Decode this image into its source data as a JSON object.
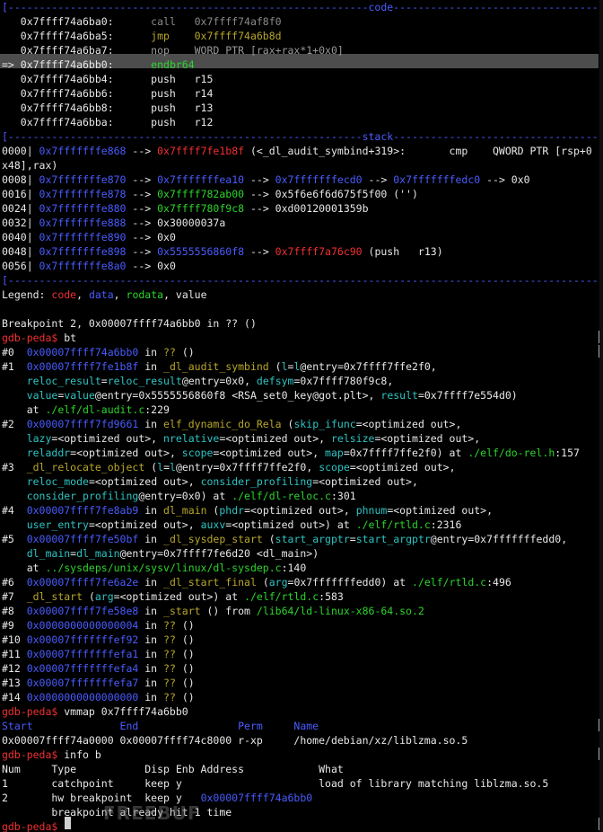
{
  "colors": {
    "background": "#000000",
    "text": "#e8e8e8",
    "code_blue": "#4a5cff",
    "data_green": "#2bd52b",
    "rodata_red": "#f03030",
    "prompt_red": "#f03030",
    "cyan": "#2ec3c3",
    "yellow": "#b8a62a",
    "magenta": "#c64fc6",
    "highlight": "#4d4d4d"
  },
  "watermark": "FREEBUF",
  "lines": [
    [
      [
        "b",
        "[----------------------------------------------------------code-------------------------------------------------------]"
      ]
    ],
    [
      [
        "w",
        "   0x7ffff74a6ba0:      "
      ],
      [
        "d",
        "call   0x7ffff74af8f0"
      ]
    ],
    [
      [
        "w",
        "   0x7ffff74a6ba5:      "
      ],
      [
        "y",
        "jmp    0x7ffff74a6b8d"
      ]
    ],
    [
      [
        "w",
        "   0x7ffff74a6ba7:      "
      ],
      [
        "dim",
        "nop    WORD PTR [rax+rax*1+0x0]"
      ]
    ],
    [
      [
        "w",
        "=> 0x7ffff74a6bb0:      "
      ],
      [
        "g",
        "endbr64"
      ]
    ],
    [
      [
        "w",
        "   0x7ffff74a6bb4:      push   r15"
      ]
    ],
    [
      [
        "w",
        "   0x7ffff74a6bb6:      push   r14"
      ]
    ],
    [
      [
        "w",
        "   0x7ffff74a6bb8:      push   r13"
      ]
    ],
    [
      [
        "w",
        "   0x7ffff74a6bba:      push   r12"
      ]
    ],
    [
      [
        "b",
        "[---------------------------------------------------------stack-------------------------------------------------------]"
      ]
    ],
    [
      [
        "w",
        "0000| "
      ],
      [
        "b",
        "0x7fffffffe868"
      ],
      [
        "w",
        " --> "
      ],
      [
        "r",
        "0x7ffff7fe1b8f"
      ],
      [
        "w",
        " (<_dl_audit_symbind+319>:       cmp    QWORD PTR [rsp+0"
      ]
    ],
    [
      [
        "w",
        "x48],rax)"
      ]
    ],
    [
      [
        "w",
        "0008| "
      ],
      [
        "b",
        "0x7fffffffe870"
      ],
      [
        "w",
        " --> "
      ],
      [
        "b",
        "0x7fffffffea10"
      ],
      [
        "w",
        " --> "
      ],
      [
        "b",
        "0x7fffffffecd0"
      ],
      [
        "w",
        " --> "
      ],
      [
        "b",
        "0x7fffffffedc0"
      ],
      [
        "w",
        " --> 0x0"
      ]
    ],
    [
      [
        "w",
        "0016| "
      ],
      [
        "b",
        "0x7fffffffe878"
      ],
      [
        "w",
        " --> "
      ],
      [
        "g",
        "0x7ffff782ab00"
      ],
      [
        "w",
        " --> 0x5f6e6f6d675f5f00 ('')"
      ]
    ],
    [
      [
        "w",
        "0024| "
      ],
      [
        "b",
        "0x7fffffffe880"
      ],
      [
        "w",
        " --> "
      ],
      [
        "g",
        "0x7ffff780f9c8"
      ],
      [
        "w",
        " --> 0xd00120001359b"
      ]
    ],
    [
      [
        "w",
        "0032| "
      ],
      [
        "b",
        "0x7fffffffe888"
      ],
      [
        "w",
        " --> 0x30000037a"
      ]
    ],
    [
      [
        "w",
        "0040| "
      ],
      [
        "b",
        "0x7fffffffe890"
      ],
      [
        "w",
        " --> 0x0"
      ]
    ],
    [
      [
        "w",
        "0048| "
      ],
      [
        "b",
        "0x7fffffffe898"
      ],
      [
        "w",
        " --> "
      ],
      [
        "b",
        "0x5555556860f8"
      ],
      [
        "w",
        " --> "
      ],
      [
        "r",
        "0x7ffff7a76c90"
      ],
      [
        "w",
        " (push   r13)"
      ]
    ],
    [
      [
        "w",
        "0056| "
      ],
      [
        "b",
        "0x7fffffffe8a0"
      ],
      [
        "w",
        " --> 0x0"
      ]
    ],
    [
      [
        "b",
        "[-------------------------------------------------------------------------------------------------------------------]"
      ]
    ],
    [
      [
        "w",
        "Legend: "
      ],
      [
        "r",
        "code"
      ],
      [
        "w",
        ", "
      ],
      [
        "b",
        "data"
      ],
      [
        "w",
        ", "
      ],
      [
        "g",
        "rodata"
      ],
      [
        "w",
        ", value"
      ]
    ],
    [
      [
        "w",
        ""
      ]
    ],
    [
      [
        "w",
        "Breakpoint 2, 0x00007ffff74a6bb0 in ?? ()"
      ]
    ],
    [
      [
        "r",
        "gdb-peda$"
      ],
      [
        "w",
        " bt"
      ]
    ],
    [
      [
        "w",
        "#0  "
      ],
      [
        "b",
        "0x00007ffff74a6bb0"
      ],
      [
        "w",
        " in "
      ],
      [
        "y",
        "??"
      ],
      [
        "w",
        " ()"
      ]
    ],
    [
      [
        "w",
        "#1  "
      ],
      [
        "b",
        "0x00007ffff7fe1b8f"
      ],
      [
        "w",
        " in "
      ],
      [
        "y",
        "_dl_audit_symbind"
      ],
      [
        "w",
        " ("
      ],
      [
        "c",
        "l"
      ],
      [
        "w",
        "="
      ],
      [
        "c",
        "l"
      ],
      [
        "w",
        "@entry=0x7ffff7ffe2f0,"
      ]
    ],
    [
      [
        "w",
        "    "
      ],
      [
        "c",
        "reloc_result"
      ],
      [
        "w",
        "="
      ],
      [
        "c",
        "reloc_result"
      ],
      [
        "w",
        "@entry=0x0, "
      ],
      [
        "c",
        "defsym"
      ],
      [
        "w",
        "=0x7ffff780f9c8,"
      ]
    ],
    [
      [
        "w",
        "    "
      ],
      [
        "c",
        "value"
      ],
      [
        "w",
        "="
      ],
      [
        "c",
        "value"
      ],
      [
        "w",
        "@entry=0x5555556860f8 <RSA_set0_key@got.plt>, "
      ],
      [
        "c",
        "result"
      ],
      [
        "w",
        "=0x7ffff7e554d0)"
      ]
    ],
    [
      [
        "w",
        "    at "
      ],
      [
        "g",
        "./elf/dl-audit.c"
      ],
      [
        "w",
        ":229"
      ]
    ],
    [
      [
        "w",
        "#2  "
      ],
      [
        "b",
        "0x00007ffff7fd9661"
      ],
      [
        "w",
        " in "
      ],
      [
        "y",
        "elf_dynamic_do_Rela"
      ],
      [
        "w",
        " ("
      ],
      [
        "c",
        "skip_ifunc"
      ],
      [
        "w",
        "=<optimized out>,"
      ]
    ],
    [
      [
        "w",
        "    "
      ],
      [
        "c",
        "lazy"
      ],
      [
        "w",
        "=<optimized out>, "
      ],
      [
        "c",
        "nrelative"
      ],
      [
        "w",
        "=<optimized out>, "
      ],
      [
        "c",
        "relsize"
      ],
      [
        "w",
        "=<optimized out>,"
      ]
    ],
    [
      [
        "w",
        "    "
      ],
      [
        "c",
        "reladdr"
      ],
      [
        "w",
        "=<optimized out>, "
      ],
      [
        "c",
        "scope"
      ],
      [
        "w",
        "=<optimized out>, "
      ],
      [
        "c",
        "map"
      ],
      [
        "w",
        "=0x7ffff7ffe2f0) at "
      ],
      [
        "g",
        "./elf/do-rel.h"
      ],
      [
        "w",
        ":157"
      ]
    ],
    [
      [
        "w",
        "#3  "
      ],
      [
        "y",
        "_dl_relocate_object"
      ],
      [
        "w",
        " ("
      ],
      [
        "c",
        "l"
      ],
      [
        "w",
        "="
      ],
      [
        "c",
        "l"
      ],
      [
        "w",
        "@entry=0x7ffff7ffe2f0, "
      ],
      [
        "c",
        "scope"
      ],
      [
        "w",
        "=<optimized out>,"
      ]
    ],
    [
      [
        "w",
        "    "
      ],
      [
        "c",
        "reloc_mode"
      ],
      [
        "w",
        "=<optimized out>, "
      ],
      [
        "c",
        "consider_profiling"
      ],
      [
        "w",
        "=<optimized out>,"
      ]
    ],
    [
      [
        "w",
        "    "
      ],
      [
        "c",
        "consider_profiling"
      ],
      [
        "w",
        "@entry=0x0) at "
      ],
      [
        "g",
        "./elf/dl-reloc.c"
      ],
      [
        "w",
        ":301"
      ]
    ],
    [
      [
        "w",
        "#4  "
      ],
      [
        "b",
        "0x00007ffff7fe8ab9"
      ],
      [
        "w",
        " in "
      ],
      [
        "y",
        "dl_main"
      ],
      [
        "w",
        " ("
      ],
      [
        "c",
        "phdr"
      ],
      [
        "w",
        "=<optimized out>, "
      ],
      [
        "c",
        "phnum"
      ],
      [
        "w",
        "=<optimized out>,"
      ]
    ],
    [
      [
        "w",
        "    "
      ],
      [
        "c",
        "user_entry"
      ],
      [
        "w",
        "=<optimized out>, "
      ],
      [
        "c",
        "auxv"
      ],
      [
        "w",
        "=<optimized out>) at "
      ],
      [
        "g",
        "./elf/rtld.c"
      ],
      [
        "w",
        ":2316"
      ]
    ],
    [
      [
        "w",
        "#5  "
      ],
      [
        "b",
        "0x00007ffff7fe50bf"
      ],
      [
        "w",
        " in "
      ],
      [
        "y",
        "_dl_sysdep_start"
      ],
      [
        "w",
        " ("
      ],
      [
        "c",
        "start_argptr"
      ],
      [
        "w",
        "="
      ],
      [
        "c",
        "start_argptr"
      ],
      [
        "w",
        "@entry=0x7fffffffedd0,"
      ]
    ],
    [
      [
        "w",
        "    "
      ],
      [
        "c",
        "dl_main"
      ],
      [
        "w",
        "="
      ],
      [
        "c",
        "dl_main"
      ],
      [
        "w",
        "@entry=0x7ffff7fe6d20 <dl_main>)"
      ]
    ],
    [
      [
        "w",
        "    at "
      ],
      [
        "g",
        "../sysdeps/unix/sysv/linux/dl-sysdep.c"
      ],
      [
        "w",
        ":140"
      ]
    ],
    [
      [
        "w",
        "#6  "
      ],
      [
        "b",
        "0x00007ffff7fe6a2e"
      ],
      [
        "w",
        " in "
      ],
      [
        "y",
        "_dl_start_final"
      ],
      [
        "w",
        " ("
      ],
      [
        "c",
        "arg"
      ],
      [
        "w",
        "=0x7fffffffedd0) at "
      ],
      [
        "g",
        "./elf/rtld.c"
      ],
      [
        "w",
        ":496"
      ]
    ],
    [
      [
        "w",
        "#7  "
      ],
      [
        "y",
        "_dl_start"
      ],
      [
        "w",
        " ("
      ],
      [
        "c",
        "arg"
      ],
      [
        "w",
        "=<optimized out>) at "
      ],
      [
        "g",
        "./elf/rtld.c"
      ],
      [
        "w",
        ":583"
      ]
    ],
    [
      [
        "w",
        "#8  "
      ],
      [
        "b",
        "0x00007ffff7fe58e8"
      ],
      [
        "w",
        " in "
      ],
      [
        "y",
        "_start"
      ],
      [
        "w",
        " () from "
      ],
      [
        "g",
        "/lib64/ld-linux-x86-64.so.2"
      ]
    ],
    [
      [
        "w",
        "#9  "
      ],
      [
        "b",
        "0x0000000000000004"
      ],
      [
        "w",
        " in "
      ],
      [
        "y",
        "??"
      ],
      [
        "w",
        " ()"
      ]
    ],
    [
      [
        "w",
        "#10 "
      ],
      [
        "b",
        "0x00007fffffffef92"
      ],
      [
        "w",
        " in "
      ],
      [
        "y",
        "??"
      ],
      [
        "w",
        " ()"
      ]
    ],
    [
      [
        "w",
        "#11 "
      ],
      [
        "b",
        "0x00007fffffffefa1"
      ],
      [
        "w",
        " in "
      ],
      [
        "y",
        "??"
      ],
      [
        "w",
        " ()"
      ]
    ],
    [
      [
        "w",
        "#12 "
      ],
      [
        "b",
        "0x00007fffffffefa4"
      ],
      [
        "w",
        " in "
      ],
      [
        "y",
        "??"
      ],
      [
        "w",
        " ()"
      ]
    ],
    [
      [
        "w",
        "#13 "
      ],
      [
        "b",
        "0x00007fffffffefa7"
      ],
      [
        "w",
        " in "
      ],
      [
        "y",
        "??"
      ],
      [
        "w",
        " ()"
      ]
    ],
    [
      [
        "w",
        "#14 "
      ],
      [
        "b",
        "0x0000000000000000"
      ],
      [
        "w",
        " in "
      ],
      [
        "y",
        "??"
      ],
      [
        "w",
        " ()"
      ]
    ],
    [
      [
        "r",
        "gdb-peda$"
      ],
      [
        "w",
        " vmmap 0x7ffff74a6bb0"
      ]
    ],
    [
      [
        "b",
        "Start              End                Perm     Name"
      ]
    ],
    [
      [
        "w",
        "0x00007ffff74a0000 0x00007ffff74c8000 r-xp     /home/debian/xz/liblzma.so.5"
      ]
    ],
    [
      [
        "r",
        "gdb-peda$"
      ],
      [
        "w",
        " info b"
      ]
    ],
    [
      [
        "w",
        "Num     Type           Disp Enb Address            What"
      ]
    ],
    [
      [
        "w",
        "1       catchpoint     keep y                      load of library matching liblzma.so.5"
      ]
    ],
    [
      [
        "w",
        "2       hw breakpoint  keep y   "
      ],
      [
        "b",
        "0x00007ffff74a6bb0"
      ]
    ],
    [
      [
        "w",
        "        breakpoint already hit 1 time"
      ]
    ],
    [
      [
        "r",
        "gdb-peda$"
      ],
      [
        "w",
        " "
      ]
    ]
  ]
}
